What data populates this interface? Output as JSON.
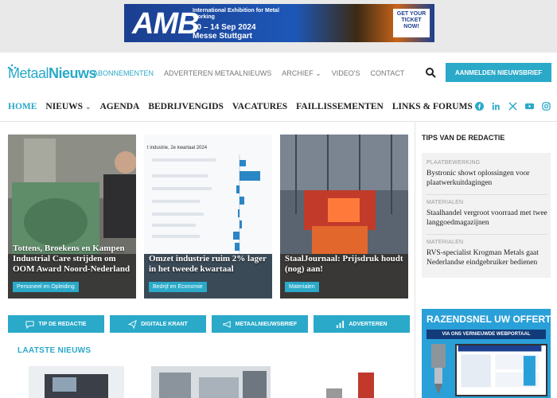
{
  "ad_top": {
    "brand": "AMB",
    "subtitle": "International Exhibition for Metal Working",
    "dates": "10 – 14 Sep 2024",
    "venue": "Messe Stuttgart",
    "cta": "GET YOUR TICKET NOW!"
  },
  "header": {
    "logo_part1": "Metaal",
    "logo_part2": "Nieuws",
    "topnav": [
      "ABONNEMENTEN",
      "ADVERTEREN METAALNIEUWS",
      "ARCHIEF",
      "VIDEO'S",
      "CONTACT"
    ],
    "signup_label": "AANMELDEN NIEUWSBRIEF"
  },
  "mainnav": {
    "items": [
      "HOME",
      "NIEUWS",
      "AGENDA",
      "BEDRIJVENGIDS",
      "VACATURES",
      "FAILLISSEMENTEN",
      "LINKS & FORUMS"
    ]
  },
  "social_icons": [
    "facebook-icon",
    "linkedin-icon",
    "x-icon",
    "youtube-icon",
    "instagram-icon"
  ],
  "featured": [
    {
      "title": "Tottens, Broekens en Kampen Industrial Care strijden om OOM Award Noord-Nederland",
      "tag": "Personeel en Opleiding"
    },
    {
      "title": "Omzet industrie ruim 2% lager in het tweede kwartaal",
      "tag": "Bedrijf en Economie",
      "chart_heading": "t industrie, 2e kwartaal 2024"
    },
    {
      "title": "StaalJournaal: Prijsdruk houdt (nog) aan!",
      "tag": "Materialen"
    }
  ],
  "actions": [
    {
      "label": "TIP DE REDACTIE",
      "icon": "chat-icon"
    },
    {
      "label": "DIGITALE KRANT",
      "icon": "send-icon"
    },
    {
      "label": "METAALNIEUWSBRIEF",
      "icon": "megaphone-icon"
    },
    {
      "label": "ADVERTEREN",
      "icon": "bar-chart-icon"
    }
  ],
  "latest_heading": "LAATSTE NIEUWS",
  "sidebar": {
    "heading": "TIPS VAN DE REDACTIE",
    "items": [
      {
        "category": "PLAATBEWERKING",
        "title": "Bystronic showt oplossingen voor plaatwerkuitdagingen"
      },
      {
        "category": "MATERIALEN",
        "title": "Staalhandel vergroot voorraad met twee langgoedmagazijnen"
      },
      {
        "category": "MATERIALEN",
        "title": "RVS-specialist Krogman Metals gaat Nederlandse eindgebruiker bedienen"
      }
    ]
  },
  "ad_side": {
    "line1": "RAZENDSNEL UW OFFERTE",
    "line2": "VIA ONS VERNIEUWDE WEBPORTAAL"
  },
  "colors": {
    "accent": "#2aa9c9",
    "ad_blue": "#1c3f8f"
  }
}
